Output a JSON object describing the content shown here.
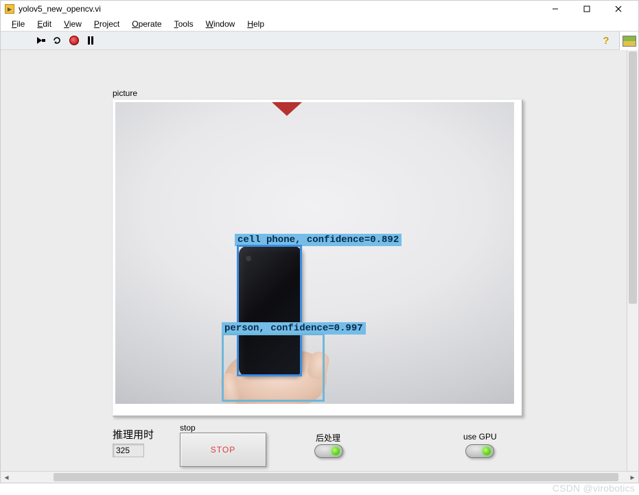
{
  "window": {
    "title": "yolov5_new_opencv.vi"
  },
  "menu": {
    "file": "File",
    "edit": "Edit",
    "view": "View",
    "project": "Project",
    "operate": "Operate",
    "tools": "Tools",
    "window": "Window",
    "help": "Help"
  },
  "toolbar": {
    "run": "run-arrow",
    "run_continuous": "run-continuous",
    "abort": "abort",
    "pause": "pause",
    "help": "?"
  },
  "picture": {
    "label": "picture",
    "detections": [
      {
        "label": "cell phone, confidence=0.892"
      },
      {
        "label": "person, confidence=0.997"
      }
    ]
  },
  "controls": {
    "inference_time_label": "推理用时",
    "inference_time_value": "325",
    "stop_label": "stop",
    "stop_button_text": "STOP",
    "postprocess_label": "后处理",
    "use_gpu_label": "use GPU"
  },
  "watermark": "CSDN @virobotics"
}
